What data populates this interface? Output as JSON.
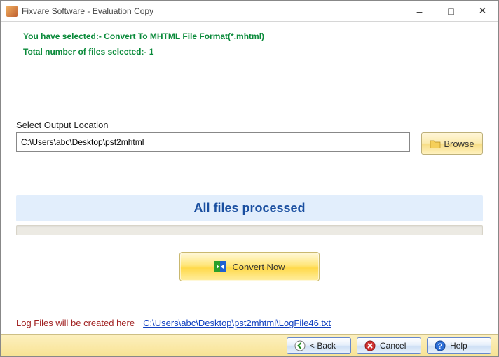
{
  "window": {
    "title": "Fixvare Software - Evaluation Copy"
  },
  "info": {
    "selection_line": "You have selected:- Convert To MHTML File Format(*.mhtml)",
    "count_line": "Total number of files selected:- 1"
  },
  "output": {
    "label": "Select Output Location",
    "path": "C:\\Users\\abc\\Desktop\\pst2mhtml",
    "browse_label": "Browse"
  },
  "progress": {
    "caption": "All files processed"
  },
  "convert": {
    "label": "Convert Now"
  },
  "log": {
    "label": "Log Files will be created here",
    "link": "C:\\Users\\abc\\Desktop\\pst2mhtml\\LogFile46.txt"
  },
  "buttons": {
    "back": "< Back",
    "cancel": "Cancel",
    "help": "Help"
  }
}
